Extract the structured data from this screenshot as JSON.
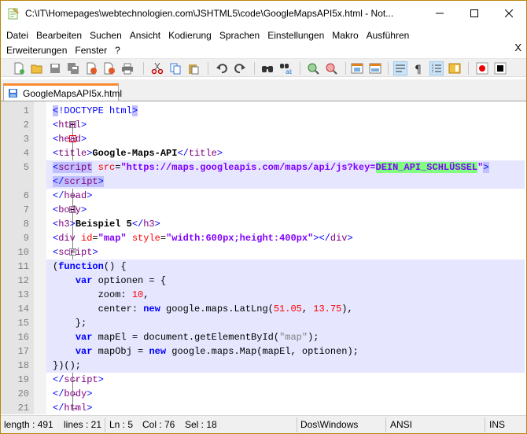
{
  "window": {
    "title": "C:\\IT\\Homepages\\webtechnologien.com\\JSHTML5\\code\\GoogleMapsAPI5x.html - Not..."
  },
  "menu": {
    "row1": [
      "Datei",
      "Bearbeiten",
      "Suchen",
      "Ansicht",
      "Kodierung",
      "Sprachen",
      "Einstellungen",
      "Makro",
      "Ausführen"
    ],
    "row2": [
      "Erweiterungen",
      "Fenster",
      "?"
    ],
    "close": "X"
  },
  "tabs": [
    {
      "label": "GoogleMapsAPI5x.html"
    }
  ],
  "editor": {
    "line_numbers": [
      "1",
      "2",
      "3",
      "4",
      "5",
      "6",
      "7",
      "8",
      "9",
      "10",
      "11",
      "12",
      "13",
      "14",
      "15",
      "16",
      "17",
      "18",
      "19",
      "20",
      "21"
    ]
  },
  "status": {
    "length": "length : 491",
    "lines": "lines : 21",
    "ln": "Ln : 5",
    "col": "Col : 76",
    "sel": "Sel : 18",
    "eol": "Dos\\Windows",
    "encoding": "ANSI",
    "mode": "INS"
  },
  "icons": [
    "new-file-icon",
    "open-file-icon",
    "save-icon",
    "save-all-icon",
    "close-icon",
    "close-all-icon",
    "print-icon",
    "cut-icon",
    "copy-icon",
    "paste-icon",
    "undo-icon",
    "redo-icon",
    "find-icon",
    "replace-icon",
    "zoom-in-icon",
    "zoom-out-icon",
    "sync-v-icon",
    "sync-h-icon",
    "word-wrap-icon",
    "show-all-chars-icon",
    "indent-guide-icon",
    "doc-map-icon",
    "record-macro-icon",
    "stop-macro-icon"
  ],
  "colors": {
    "tab_accent": "#fa8a2f",
    "tag": "#0000ff",
    "attr": "#ff0000",
    "attr_value": "#8000ff",
    "keyword": "#0000ff",
    "number": "#ff0000",
    "string": "#808080",
    "highlight": "#80ff80",
    "line_hl": "#e6e6ff"
  }
}
